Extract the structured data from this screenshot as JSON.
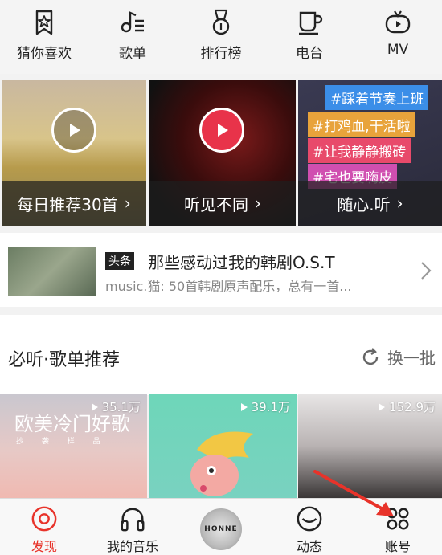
{
  "categories": [
    {
      "label": "猜你喜欢",
      "icon": "star-bookmark-icon"
    },
    {
      "label": "歌单",
      "icon": "music-list-icon"
    },
    {
      "label": "排行榜",
      "icon": "medal-icon"
    },
    {
      "label": "电台",
      "icon": "coffee-cup-icon"
    },
    {
      "label": "MV",
      "icon": "tv-icon"
    }
  ],
  "tiles": [
    {
      "caption": "每日推荐30首",
      "icon": "play-icon"
    },
    {
      "caption": "听见不同",
      "icon": "play-icon"
    },
    {
      "caption": "随心.听"
    }
  ],
  "tags": [
    "#踩着节奏上班",
    "#打鸡血,干活啦",
    "#让我静静搬砖",
    "#宅也要嗨皮"
  ],
  "headline": {
    "badge": "头条",
    "title": "那些感动过我的韩剧O.S.T",
    "description": "music.猫: 50首韩剧原声配乐，总有一首..."
  },
  "section": {
    "title": "必听·歌单推荐",
    "refresh_label": "换一批"
  },
  "playlists": [
    {
      "plays": "35.1万",
      "title": "欧美冷门好歌",
      "subtitle": "抄 袭 样 品"
    },
    {
      "plays": "39.1万"
    },
    {
      "plays": "152.9万"
    }
  ],
  "tabbar": [
    {
      "label": "发现",
      "icon": "discover-icon",
      "active": true
    },
    {
      "label": "我的音乐",
      "icon": "headphones-icon"
    },
    {
      "label": "HONNE",
      "icon": "now-playing-disc"
    },
    {
      "label": "动态",
      "icon": "smile-face-icon"
    },
    {
      "label": "账号",
      "icon": "account-grid-icon"
    }
  ],
  "colors": {
    "accent": "#e8332a",
    "arrow": "#e8332a"
  }
}
